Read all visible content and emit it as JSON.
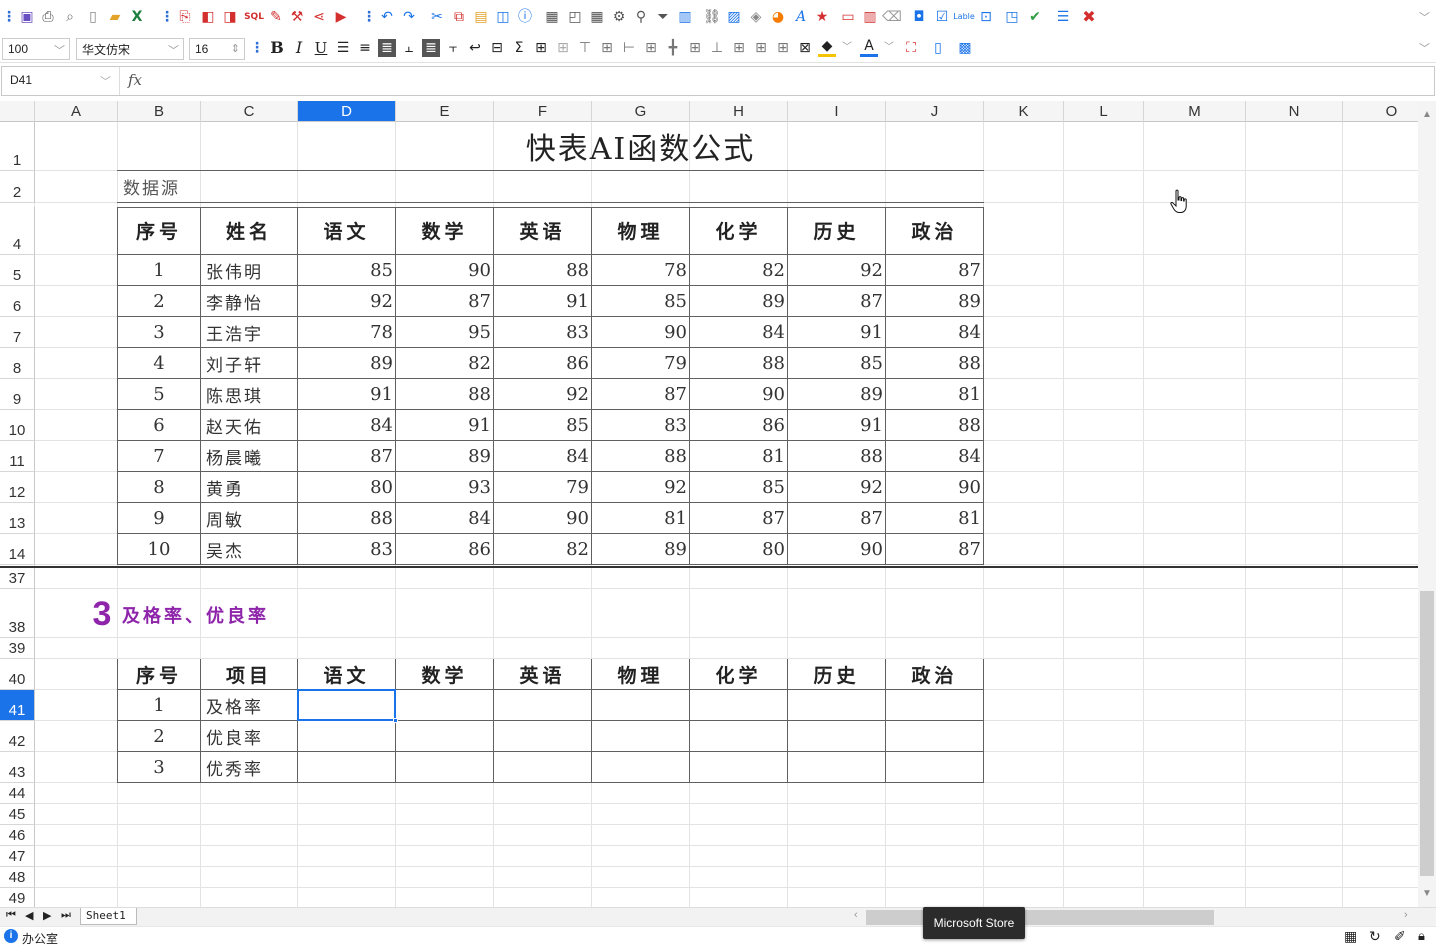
{
  "toolbar1": {
    "icons": [
      "grip-icon",
      "save-icon",
      "print-icon",
      "print-preview-icon",
      "page-setup-icon",
      "open-folder-icon",
      "excel-icon",
      "grip-icon",
      "pdf-icon",
      "export-icon",
      "image-export-icon",
      "sql-icon",
      "pen-icon",
      "wrench-icon",
      "share-icon",
      "play-icon",
      "grip-icon",
      "undo-icon",
      "redo-icon",
      "cut-icon",
      "copy-icon",
      "paste-icon",
      "format-painter-icon",
      "info-icon",
      "table-icon",
      "freeze-icon",
      "grid-icon",
      "settings-icon",
      "find-icon",
      "filter-icon",
      "chart-icon",
      "link-icon",
      "picture-icon",
      "shape-icon",
      "pie-icon",
      "text-style-icon",
      "star-icon",
      "form-icon",
      "barcode-icon",
      "eraser-icon",
      "camera-icon",
      "checkbox-icon",
      "label-icon",
      "textbox-icon",
      "report-icon",
      "check-icon",
      "list-icon",
      "close-icon"
    ],
    "label_text": "Lable"
  },
  "toolbar2": {
    "zoom": "100",
    "font_family": "华文仿宋",
    "font_size": "16",
    "icons": [
      "bold-icon",
      "italic-icon",
      "underline-icon",
      "align-left-icon",
      "align-center-icon",
      "align-justify-icon",
      "align-top-icon",
      "align-middle-icon",
      "align-bottom-icon",
      "wrap-icon",
      "merge-icon",
      "sum-icon",
      "border-all-icon",
      "border-inner-icon",
      "border-top-icon",
      "border-hmid-icon",
      "border-left-icon",
      "border-vmid-icon",
      "border-cross-icon",
      "border-outer-icon",
      "border-bottom-icon",
      "border-double-icon",
      "border-thick-icon",
      "border-box-icon",
      "fill-color-icon",
      "font-color-icon",
      "fullscreen-icon",
      "page-icon",
      "qr-code-icon"
    ],
    "fill_color": "#f5c400",
    "font_color": "#1a73e8"
  },
  "formula_bar": {
    "name_box": "D41",
    "fx": "fx",
    "value": ""
  },
  "columns": [
    "A",
    "B",
    "C",
    "D",
    "E",
    "F",
    "G",
    "H",
    "I",
    "J",
    "K",
    "L",
    "M",
    "N",
    "O"
  ],
  "selected_column": "D",
  "rows": [
    "1",
    "2",
    "4",
    "5",
    "6",
    "7",
    "8",
    "9",
    "10",
    "11",
    "12",
    "13",
    "14",
    "37",
    "38",
    "39",
    "40",
    "41",
    "42",
    "43",
    "44",
    "45",
    "46",
    "47",
    "48",
    "49"
  ],
  "selected_row": "41",
  "sheet": {
    "title": "快表AI函数公式",
    "source_label": "数据源",
    "headers": [
      "序号",
      "姓名",
      "语文",
      "数学",
      "英语",
      "物理",
      "化学",
      "历史",
      "政治"
    ],
    "students": [
      {
        "no": "1",
        "name": "张伟明",
        "scores": [
          "85",
          "90",
          "88",
          "78",
          "82",
          "92",
          "87"
        ]
      },
      {
        "no": "2",
        "name": "李静怡",
        "scores": [
          "92",
          "87",
          "91",
          "85",
          "89",
          "87",
          "89"
        ]
      },
      {
        "no": "3",
        "name": "王浩宇",
        "scores": [
          "78",
          "95",
          "83",
          "90",
          "84",
          "91",
          "84"
        ]
      },
      {
        "no": "4",
        "name": "刘子轩",
        "scores": [
          "89",
          "82",
          "86",
          "79",
          "88",
          "85",
          "88"
        ]
      },
      {
        "no": "5",
        "name": "陈思琪",
        "scores": [
          "91",
          "88",
          "92",
          "87",
          "90",
          "89",
          "81"
        ]
      },
      {
        "no": "6",
        "name": "赵天佑",
        "scores": [
          "84",
          "91",
          "85",
          "83",
          "86",
          "91",
          "88"
        ]
      },
      {
        "no": "7",
        "name": "杨晨曦",
        "scores": [
          "87",
          "89",
          "84",
          "88",
          "81",
          "88",
          "84"
        ]
      },
      {
        "no": "8",
        "name": "黄勇",
        "scores": [
          "80",
          "93",
          "79",
          "92",
          "85",
          "92",
          "90"
        ]
      },
      {
        "no": "9",
        "name": "周敏",
        "scores": [
          "88",
          "84",
          "90",
          "81",
          "87",
          "87",
          "81"
        ]
      },
      {
        "no": "10",
        "name": "吴杰",
        "scores": [
          "83",
          "86",
          "82",
          "89",
          "80",
          "90",
          "87"
        ]
      }
    ],
    "section_number": "3",
    "section_title": "及格率、优良率",
    "section_color": "#8e24aa",
    "rate_headers": [
      "序号",
      "项目",
      "语文",
      "数学",
      "英语",
      "物理",
      "化学",
      "历史",
      "政治"
    ],
    "rates": [
      {
        "no": "1",
        "item": "及格率"
      },
      {
        "no": "2",
        "item": "优良率"
      },
      {
        "no": "3",
        "item": "优秀率"
      }
    ]
  },
  "sheet_tabs": [
    "Sheet1"
  ],
  "tooltip": "Microsoft Store",
  "status": {
    "label": "办公室"
  },
  "accent": "#1a73e8"
}
